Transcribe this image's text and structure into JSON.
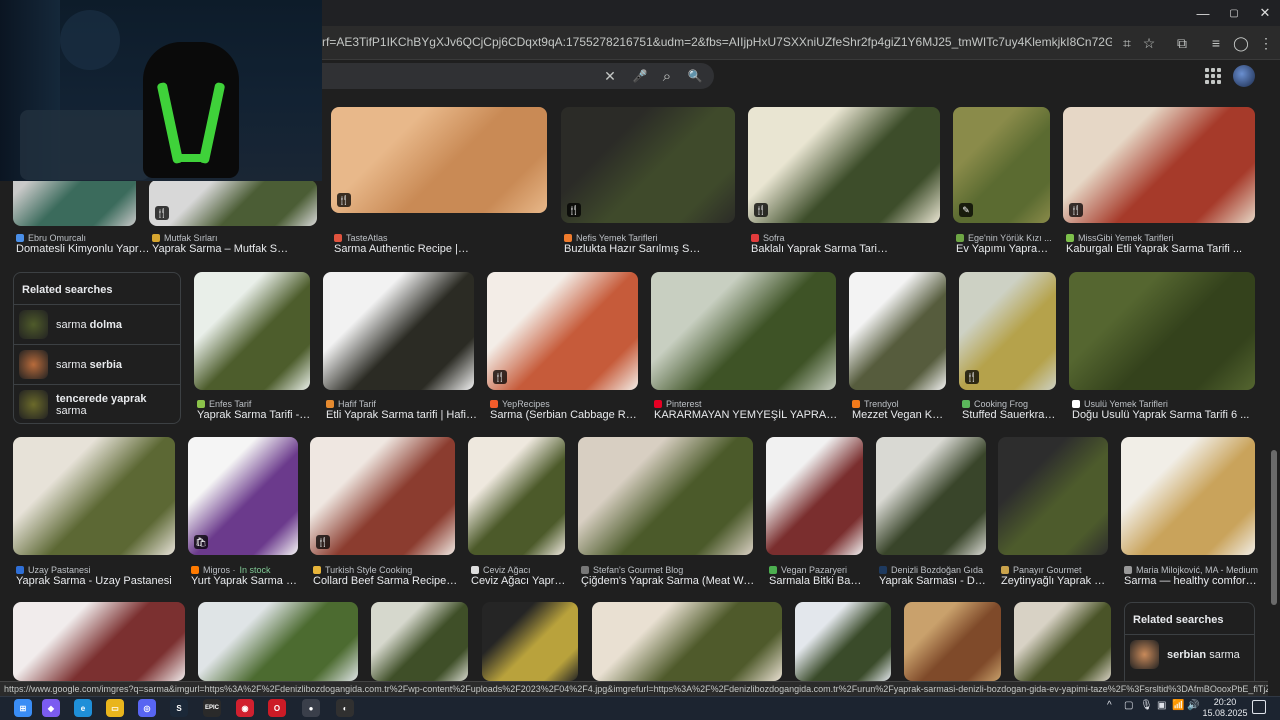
{
  "browser": {
    "url": "rf=AE3TifP1IKChBYgXJv6QCjCpj6CDqxt9qA:1755278216751&udm=2&fbs=AIIjpHxU7SXXniUZfeShr2fp4giZ1Y6MJ25_tmWITc7uy4KlemkjkI8Cn72Gp24fGkjjh6xc8y8oU3IJovU34XDyOFvE0X8cOr...",
    "window_controls": [
      "—",
      "▢",
      "✕"
    ]
  },
  "search": {
    "query": ""
  },
  "icons": {
    "clear": "✕",
    "mic": "🎤",
    "lens": "⌕",
    "search": "🔍"
  },
  "results": [
    {
      "source": "Ebru Omurcalı",
      "title": "Domatesli Kimyonlu Yaprak...",
      "fav": "#4a8fe8",
      "img": "#c9c9c9",
      "img2": "#3b6b5c",
      "badge": ""
    },
    {
      "source": "Mutfak Sırları",
      "title": "Yaprak Sarma – Mutfak Sırları – Pr...",
      "fav": "#d7a630",
      "img": "#d8d8d8",
      "img2": "#4b5d35",
      "badge": "🍴"
    },
    {
      "source": "TasteAtlas",
      "title": "Sarma Authentic Recipe | TasteAtlas",
      "fav": "#e0533e",
      "img": "#e8b88a",
      "img2": "#c98a55",
      "badge": "🍴"
    },
    {
      "source": "Nefis Yemek Tarifleri",
      "title": "Buzlukta Hazır Sarılmış Sarma Pişir...",
      "fav": "#f07b2c",
      "img": "#2b2b27",
      "img2": "#3f4a2b",
      "badge": "🍴"
    },
    {
      "source": "Sofra",
      "title": "Baklalı Yaprak Sarma Tarifi ...",
      "fav": "#e23c3c",
      "img": "#e9e5d2",
      "img2": "#3d4d2a",
      "badge": "🍴"
    },
    {
      "source": "Ege'nin Yörük Kızı ...",
      "title": "Ev Yapımı Yaprak ...",
      "fav": "#6da544",
      "img": "#8a8b4a",
      "img2": "#5b6b31",
      "badge": "✎"
    },
    {
      "source": "MissGibi Yemek Tarifleri",
      "title": "Kaburgalı Etli Yaprak Sarma Tarifi ...",
      "fav": "#7dc04b",
      "img": "#e6d7c6",
      "img2": "#a63a2a",
      "badge": "🍴"
    },
    {
      "source": "Enfes Tarif",
      "title": "Yaprak Sarma Tarifi - L...",
      "fav": "#8bc34a",
      "img": "#e9efe9",
      "img2": "#4d5d2c",
      "badge": ""
    },
    {
      "source": "Hafif Tarif",
      "title": "Etli Yaprak Sarma tarifi | Hafif T...",
      "fav": "#e58a2f",
      "img": "#f2f2f2",
      "img2": "#2b2b24",
      "badge": ""
    },
    {
      "source": "YepRecipes",
      "title": "Sarma (Serbian Cabbage Rolls...",
      "fav": "#f25c2b",
      "img": "#f3ede7",
      "img2": "#c65b3a",
      "badge": "🍴"
    },
    {
      "source": "Pinterest",
      "title": "KARARMAYAN YEMYEŞİL YAPRAK S...",
      "fav": "#e60023",
      "img": "#c8cfc1",
      "img2": "#3e5326",
      "badge": ""
    },
    {
      "source": "Trendyol",
      "title": "Mezzet Vegan Kor...",
      "fav": "#f27a1a",
      "img": "#f3f3f3",
      "img2": "#565c3d",
      "badge": ""
    },
    {
      "source": "Cooking Frog",
      "title": "Stuffed Sauerkraut...",
      "fav": "#5bb75b",
      "img": "#cdd1c4",
      "img2": "#b5a24b",
      "badge": "🍴"
    },
    {
      "source": "Usulü Yemek Tarifleri",
      "title": "Doğu Usulü Yaprak Sarma Tarifi 6 ...",
      "fav": "#ffffff",
      "img": "#556630",
      "img2": "#34421c",
      "badge": ""
    },
    {
      "source": "Uzay Pastanesi",
      "title": "Yaprak Sarma - Uzay Pastanesi",
      "fav": "#2f6fd6",
      "img": "#e7e2d8",
      "img2": "#5c6834",
      "badge": ""
    },
    {
      "source": "Migros · ",
      "stock": "In stock",
      "title": "Yurt Yaprak Sarma 40...",
      "fav": "#ff7a00",
      "img": "#f5f5f5",
      "img2": "#6b3a8c",
      "badge": "🛍"
    },
    {
      "source": "Turkish Style Cooking",
      "title": "Collard Beef Sarma Recipe | ...",
      "fav": "#e7b43a",
      "img": "#efe7e1",
      "img2": "#8b3c2f",
      "badge": "🍴"
    },
    {
      "source": "Ceviz Ağacı",
      "title": "Ceviz Ağacı Yapra...",
      "fav": "#dddddd",
      "img": "#eee8de",
      "img2": "#4c5a2a",
      "badge": ""
    },
    {
      "source": "Stefan's Gourmet Blog",
      "title": "Çiğdem's Yaprak Sarma (Meat Wrap...",
      "fav": "#777777",
      "img": "#d8cfc2",
      "img2": "#4b5a2a",
      "badge": ""
    },
    {
      "source": "Vegan Pazaryeri",
      "title": "Sarmala Bitki Bazlı...",
      "fav": "#4caf50",
      "img": "#f1f1f1",
      "img2": "#7a2e2e",
      "badge": ""
    },
    {
      "source": "Denizli Bozdoğan Gıda",
      "title": "Yaprak Sarması - Den...",
      "fav": "#1e3a5f",
      "img": "#d9d9d3",
      "img2": "#39452a",
      "badge": ""
    },
    {
      "source": "Panayır Gourmet",
      "title": "Zeytinyağlı Yaprak Sa...",
      "fav": "#c9a24b",
      "img": "#2d2d2d",
      "img2": "#4d5b2c",
      "badge": ""
    },
    {
      "source": "Maria Milojković, MA - Medium",
      "title": "Sarma — healthy comfort fo...",
      "fav": "#999999",
      "img": "#f1eee7",
      "img2": "#c9a35b",
      "badge": ""
    },
    {
      "source": "",
      "title": "",
      "fav": "",
      "img": "#f1ecec",
      "img2": "#7b3030",
      "badge": ""
    },
    {
      "source": "",
      "title": "",
      "fav": "",
      "img": "#dfe4e6",
      "img2": "#4c6b30",
      "badge": ""
    },
    {
      "source": "",
      "title": "",
      "fav": "",
      "img": "#d6d8cd",
      "img2": "#3f4f28",
      "badge": ""
    },
    {
      "source": "",
      "title": "",
      "fav": "",
      "img": "#252525",
      "img2": "#b9a23c",
      "badge": ""
    },
    {
      "source": "",
      "title": "",
      "fav": "",
      "img": "#e9e0d2",
      "img2": "#4f5a2b",
      "badge": ""
    },
    {
      "source": "",
      "title": "",
      "fav": "",
      "img": "#e3e7ec",
      "img2": "#3a4b2a",
      "badge": ""
    },
    {
      "source": "",
      "title": "",
      "fav": "",
      "img": "#c9a16c",
      "img2": "#7f4a2a",
      "badge": ""
    },
    {
      "source": "",
      "title": "",
      "fav": "",
      "img": "#d8d2c5",
      "img2": "#4a5428",
      "badge": ""
    }
  ],
  "related1": {
    "heading": "Related searches",
    "items": [
      {
        "pre": "sarma ",
        "bold": "dolma",
        "post": "",
        "color": "#4f5b2a"
      },
      {
        "pre": "sarma ",
        "bold": "serbia",
        "post": "",
        "color": "#b86b3b"
      },
      {
        "pre": "",
        "bold": "tencerede yaprak",
        "post": " sarma",
        "color": "#6b6a2a"
      }
    ]
  },
  "related2": {
    "heading": "Related searches",
    "items": [
      {
        "pre": "",
        "bold": "serbian",
        "post": " sarma",
        "color": "#c98a5a"
      }
    ]
  },
  "status_url": "https://www.google.com/imgres?q=sarma&imgurl=https%3A%2F%2Fdenizlibozdogangida.com.tr%2Fwp-content%2Fuploads%2F2023%2F04%2F4.jpg&imgrefurl=https%3A%2F%2Fdenizlibozdogangida.com.tr%2Furun%2Fyaprak-sarmasi-denizli-bozdogan-gida-ev-yapimi-taze%2F%3Fsrsltid%3DAfmBOooxPbE_fiTjZOdqEY-Hoa4rJ8DGaUiVv5p3oqTaNZi...",
  "taskbar": {
    "time": "20:20",
    "date": "15.08.2025",
    "apps": [
      {
        "name": "windows-start",
        "glyph": "⊞",
        "color": "#3a8df5"
      },
      {
        "name": "copilot",
        "glyph": "◆",
        "color": "#7b5cf0"
      },
      {
        "name": "edge",
        "glyph": "e",
        "color": "#1f8fd8"
      },
      {
        "name": "file-explorer",
        "glyph": "▭",
        "color": "#e9b51d"
      },
      {
        "name": "discord",
        "glyph": "◎",
        "color": "#5865f2"
      },
      {
        "name": "steam",
        "glyph": "S",
        "color": "#1b2838"
      },
      {
        "name": "epic",
        "glyph": "EPIC",
        "color": "#2a2a2a"
      },
      {
        "name": "app-red",
        "glyph": "◉",
        "color": "#d1202f"
      },
      {
        "name": "opera",
        "glyph": "O",
        "color": "#cc1b26"
      },
      {
        "name": "chrome",
        "glyph": "●",
        "color": "#3a3f4a"
      },
      {
        "name": "obs",
        "glyph": "◐",
        "color": "#303030"
      }
    ],
    "tray": [
      "^",
      "▢",
      "🎙",
      "▣",
      "📶",
      "🔊"
    ]
  }
}
